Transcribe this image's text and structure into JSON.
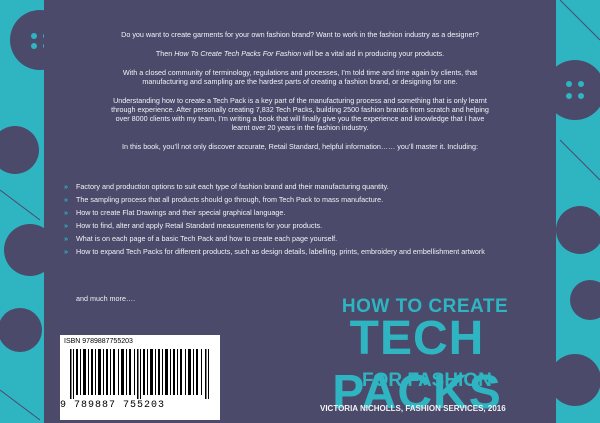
{
  "colors": {
    "accent": "#2fb5c2",
    "panel": "#4b4a6b",
    "text": "#f3f3f5"
  },
  "intro": {
    "p1": "Do you want to create garments for your own fashion brand? Want to work in the fashion industry as a designer?",
    "p2_before": "Then ",
    "p2_italic": "How To Create Tech Packs For Fashion",
    "p2_after": " will be a vital aid in producing your products.",
    "p3": "With a closed community of terminology, regulations and processes, I’m told time and time again by clients, that manufacturing and sampling are the hardest parts of creating a fashion brand, or designing for one.",
    "p4": "Understanding how to create a Tech Pack is a key part of the manufacturing process and something that is only learnt through experience. After personally creating 7,832 Tech Packs, building 2500 fashion brands from scratch and helping over 8000 clients with my team, I’m writing a book that will finally give you the experience and knowledge that I have learnt over 20 years in the fashion industry.",
    "p5": "In this book, you’ll not only discover accurate, Retail Standard, helpful information…… you’ll master it. Including:"
  },
  "bullets": [
    "Factory and production options to suit each type of fashion brand and their manufacturing quantity.",
    "The sampling process that all products should go through, from Tech Pack to mass manufacture.",
    "How to create Flat Drawings and their special graphical language.",
    "How to find, alter and apply Retail Standard measurements for your products.",
    "What is on each page of a basic Tech Pack and how to create each page yourself.",
    "How to expand Tech Packs for different products, such as design details, labelling, prints, embroidery and embellishment artwork"
  ],
  "bullet_mark": "»",
  "more": "and much more….",
  "title": {
    "line1": "HOW TO CREATE",
    "line2": "TECH PACKS",
    "line3": "FOR FASHION"
  },
  "author": "VICTORIA NICHOLLS,  FASHION SERVICES, 2016",
  "barcode": {
    "isbn_label": "ISBN 9789887755203",
    "digits": "9 789887 755203"
  }
}
